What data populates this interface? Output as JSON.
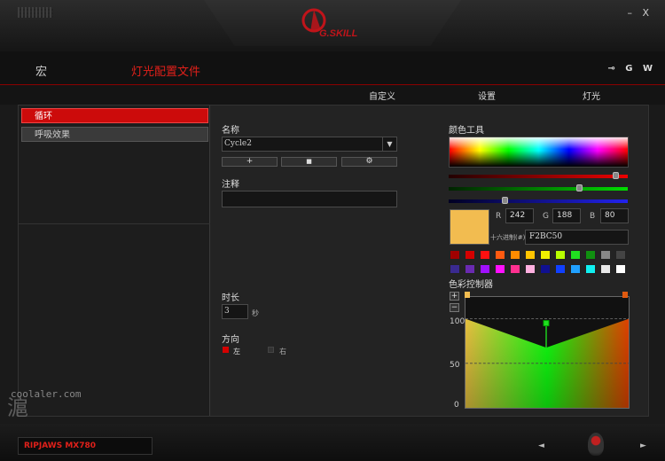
{
  "window": {
    "minimize": "–",
    "close": "X"
  },
  "brand": {
    "logo_text": "G.SKILL"
  },
  "nav": {
    "macro": "宏",
    "lighting_profile": "灯光配置文件",
    "right_icons": "⊸ G W"
  },
  "subtabs": {
    "custom": "自定义",
    "settings": "设置",
    "lighting": "灯光"
  },
  "effects": [
    "循环",
    "呼吸效果"
  ],
  "form": {
    "name_label": "名称",
    "name_value": "Cycle2",
    "note_label": "注释",
    "note_value": "",
    "duration_label": "时长",
    "duration_value": "3",
    "duration_unit": "秒",
    "direction_label": "方向",
    "dir_left": "左",
    "dir_right": "右",
    "btn_add": "+",
    "btn_stop": "■",
    "btn_settings": "⚙"
  },
  "color_tool": {
    "title": "颜色工具",
    "r_label": "R",
    "r": "242",
    "g_label": "G",
    "g": "188",
    "b_label": "B",
    "b": "80",
    "hex_label": "十六进制(#)",
    "hex": "F2BC50",
    "current_color": "#f2bc50",
    "slider_levels": {
      "r": 0.95,
      "g": 0.74,
      "b": 0.31
    },
    "presets_row1": [
      "#a00000",
      "#d40000",
      "#ff1010",
      "#ff5a10",
      "#ff8c00",
      "#ffc400",
      "#f0f000",
      "#b8ff00",
      "#20e020",
      "#109010",
      "#888888",
      "#444444"
    ],
    "presets_row2": [
      "#3a2a90",
      "#6a2ab0",
      "#a010ff",
      "#ff10ff",
      "#ff3090",
      "#ffb0e0",
      "#101090",
      "#1040ff",
      "#20a0ff",
      "#10f0f0",
      "#e8e8e8",
      "#ffffff"
    ]
  },
  "controller": {
    "title": "色彩控制器",
    "add": "+",
    "remove": "−",
    "y_ticks": [
      "100",
      "50",
      "0"
    ]
  },
  "device": {
    "model": "RIPJAWS MX780"
  },
  "watermark": {
    "text": "coolaler.com",
    "mark": "滬"
  },
  "bottom_nav": {
    "prev": "◄",
    "next": "►"
  }
}
